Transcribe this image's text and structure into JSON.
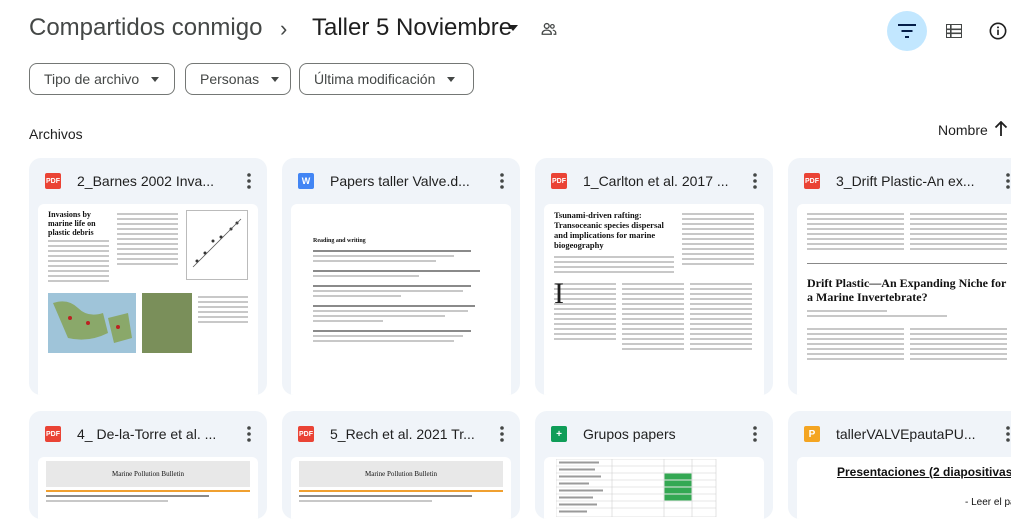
{
  "header": {
    "breadcrumb_root": "Compartidos conmigo",
    "breadcrumb_separator": "›",
    "current_folder": "Taller 5 Noviembre"
  },
  "filters": {
    "type": "Tipo de archivo",
    "people": "Personas",
    "modified": "Última modificación"
  },
  "section": {
    "label": "Archivos",
    "sort_label": "Nombre"
  },
  "colors": {
    "accent_selected": "#c2e7ff",
    "card_bg": "#f0f4f9",
    "pdf": "#ea4335",
    "word": "#4285f4",
    "sheets": "#0f9d58",
    "slides": "#f4a522"
  },
  "files": [
    {
      "name": "2_Barnes 2002 Inva...",
      "type": "PDF",
      "icon_text": "PDF",
      "thumb": {
        "title": "Invasions by marine life on plastic debris"
      }
    },
    {
      "name": "Papers taller Valve.d...",
      "type": "Word",
      "icon_text": "W",
      "thumb": {
        "title": "Reading and writing"
      }
    },
    {
      "name": "1_Carlton et al. 2017 ...",
      "type": "PDF",
      "icon_text": "PDF",
      "thumb": {
        "title": "Tsunami-driven rafting: Transoceanic species dispersal and implications for marine biogeography"
      }
    },
    {
      "name": "3_Drift Plastic-An ex...",
      "type": "PDF",
      "icon_text": "PDF",
      "thumb": {
        "title": "Drift Plastic—An Expanding Niche for a Marine Invertebrate?"
      }
    },
    {
      "name": "4_ De-la-Torre et al. ...",
      "type": "PDF",
      "icon_text": "PDF",
      "thumb": {
        "title": "Marine Pollution Bulletin"
      }
    },
    {
      "name": "5_Rech et al. 2021 Tr...",
      "type": "PDF",
      "icon_text": "PDF",
      "thumb": {
        "title": "Marine Pollution Bulletin"
      }
    },
    {
      "name": "Grupos papers",
      "type": "Sheets",
      "icon_text": "+",
      "thumb": {
        "title": ""
      }
    },
    {
      "name": "tallerVALVEpautaPU...",
      "type": "Slides",
      "icon_text": "P",
      "thumb": {
        "title": "Presentaciones (2 diapositivas",
        "bullet": "Leer el paper"
      }
    }
  ]
}
